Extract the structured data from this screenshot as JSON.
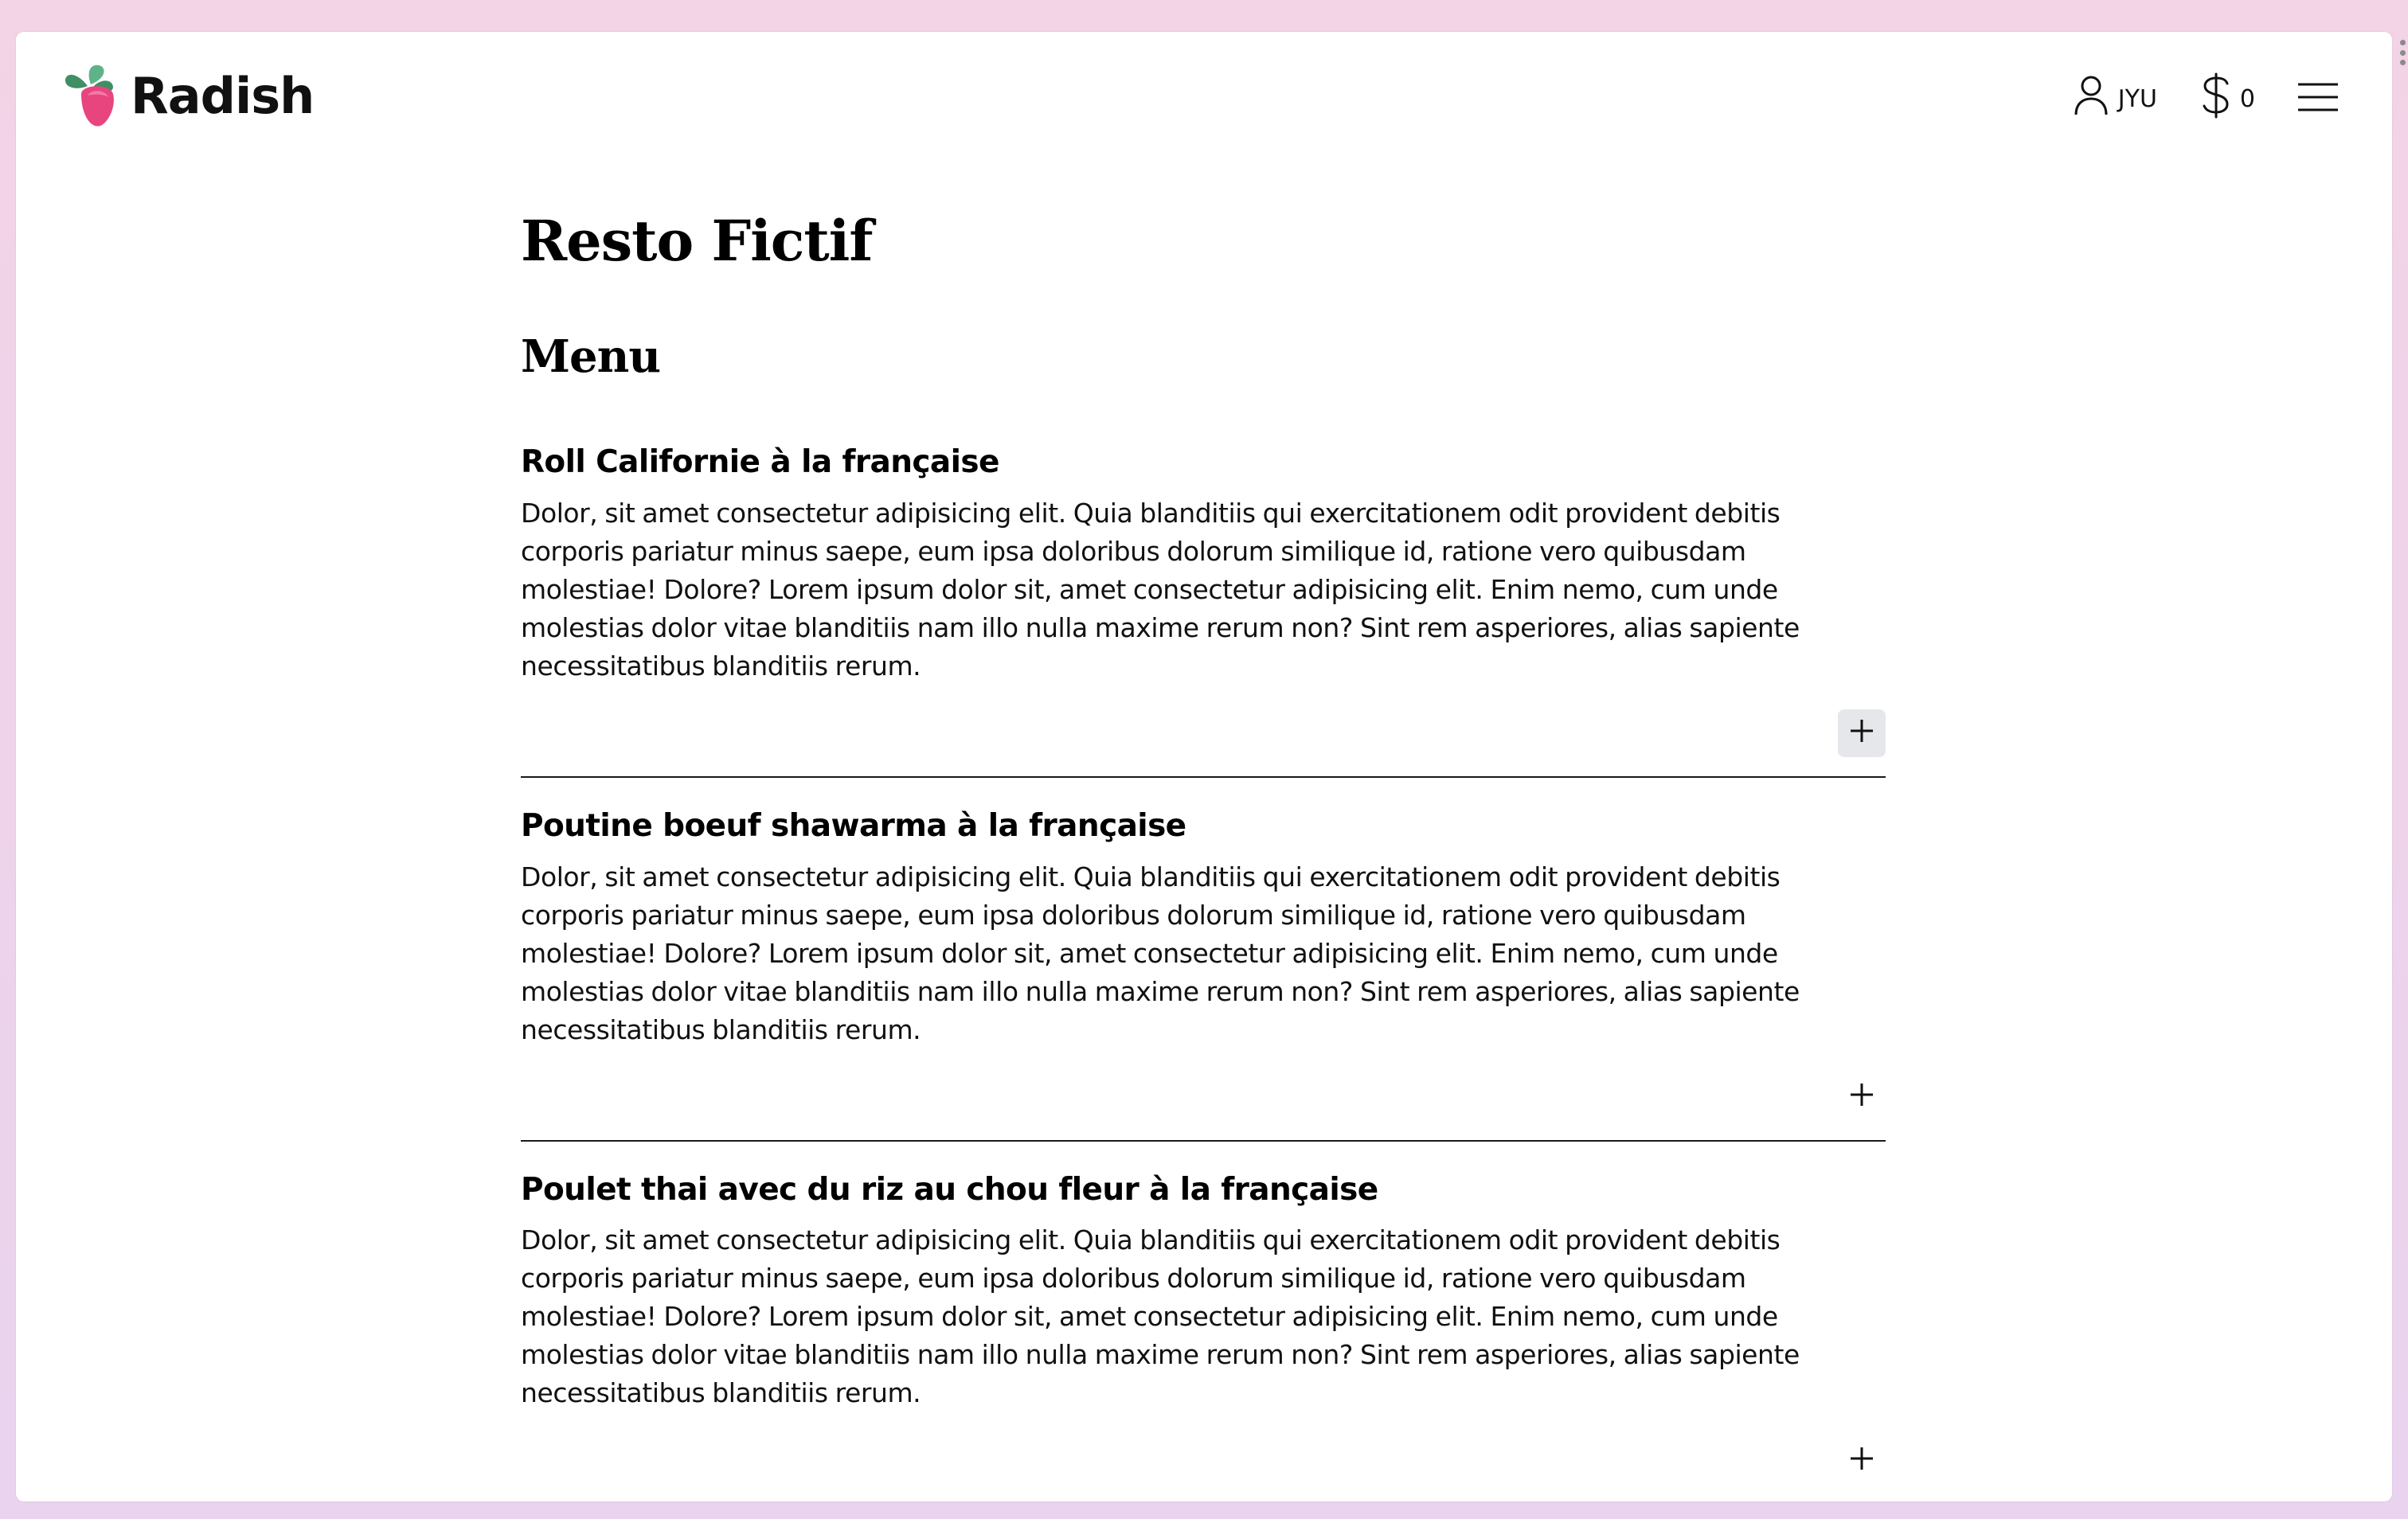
{
  "brand": {
    "name": "Radish",
    "logo_icon": "radish-icon",
    "colors": {
      "leaf": "#3e8f64",
      "leaf_light": "#5fb389",
      "root": "#e8457f",
      "root_light": "#f27aa6"
    }
  },
  "header": {
    "user": {
      "icon": "user-icon",
      "label": "JYU"
    },
    "cart": {
      "icon": "dollar-icon",
      "count": "0"
    },
    "menu_icon": "hamburger-icon"
  },
  "page": {
    "title": "Resto Fictif",
    "section_title": "Menu"
  },
  "menu_items": [
    {
      "name": "Roll Californie à la française",
      "description": "Dolor, sit amet consectetur adipisicing elit. Quia blanditiis qui exercitationem odit provident debitis corporis pariatur minus saepe, eum ipsa doloribus dolorum similique id, ratione vero quibusdam molestiae! Dolore? Lorem ipsum dolor sit, amet consectetur adipisicing elit. Enim nemo, cum unde molestias dolor vitae blanditiis nam illo nulla maxime rerum non? Sint rem asperiores, alias sapiente necessitatibus blanditiis rerum.",
      "add_icon": "plus-icon"
    },
    {
      "name": "Poutine boeuf shawarma à la française",
      "description": "Dolor, sit amet consectetur adipisicing elit. Quia blanditiis qui exercitationem odit provident debitis corporis pariatur minus saepe, eum ipsa doloribus dolorum similique id, ratione vero quibusdam molestiae! Dolore? Lorem ipsum dolor sit, amet consectetur adipisicing elit. Enim nemo, cum unde molestias dolor vitae blanditiis nam illo nulla maxime rerum non? Sint rem asperiores, alias sapiente necessitatibus blanditiis rerum.",
      "add_icon": "plus-icon"
    },
    {
      "name": "Poulet thai avec du riz au chou fleur à la française",
      "description": "Dolor, sit amet consectetur adipisicing elit. Quia blanditiis qui exercitationem odit provident debitis corporis pariatur minus saepe, eum ipsa doloribus dolorum similique id, ratione vero quibusdam molestiae! Dolore? Lorem ipsum dolor sit, amet consectetur adipisicing elit. Enim nemo, cum unde molestias dolor vitae blanditiis nam illo nulla maxime rerum non? Sint rem asperiores, alias sapiente necessitatibus blanditiis rerum.",
      "add_icon": "plus-icon"
    }
  ]
}
